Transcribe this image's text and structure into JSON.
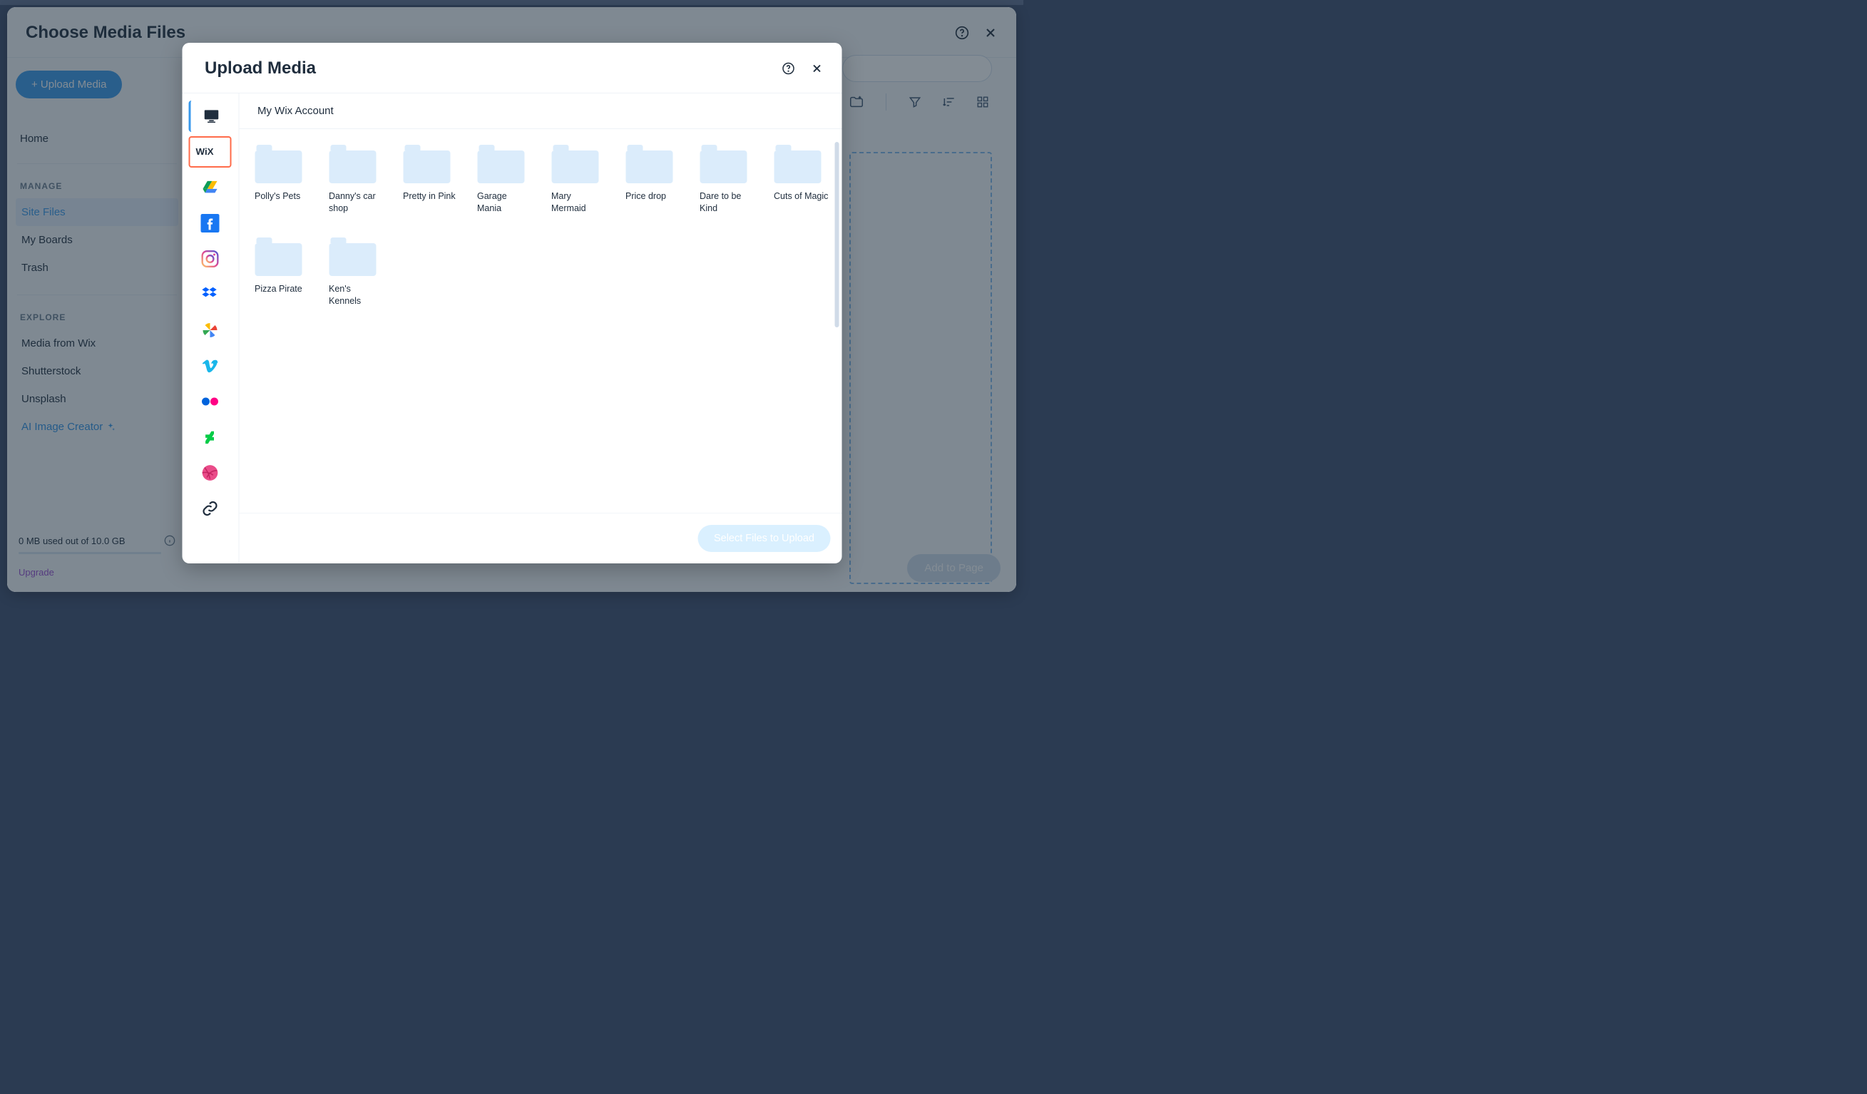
{
  "outer": {
    "title": "Choose Media Files",
    "upload_btn": "+ Upload Media",
    "home_link": "Home",
    "manage_label": "MANAGE",
    "manage_items": [
      "Site Files",
      "My Boards",
      "Trash"
    ],
    "explore_label": "EXPLORE",
    "explore_items": [
      "Media from Wix",
      "Shutterstock",
      "Unsplash"
    ],
    "ai_creator": "AI Image Creator",
    "storage_text": "0 MB used out of 10.0 GB",
    "upgrade_link": "Upgrade",
    "add_to_page": "Add to Page"
  },
  "inner": {
    "title": "Upload Media",
    "breadcrumb": "My Wix Account",
    "select_btn": "Select Files to Upload",
    "sources": [
      {
        "name": "computer",
        "active_left": true,
        "highlighted": false
      },
      {
        "name": "wix",
        "active_left": false,
        "highlighted": true
      },
      {
        "name": "gdrive",
        "active_left": false,
        "highlighted": false
      },
      {
        "name": "facebook",
        "active_left": false,
        "highlighted": false
      },
      {
        "name": "instagram",
        "active_left": false,
        "highlighted": false
      },
      {
        "name": "dropbox",
        "active_left": false,
        "highlighted": false
      },
      {
        "name": "gphotos",
        "active_left": false,
        "highlighted": false
      },
      {
        "name": "vimeo",
        "active_left": false,
        "highlighted": false
      },
      {
        "name": "flickr",
        "active_left": false,
        "highlighted": false
      },
      {
        "name": "deviantart",
        "active_left": false,
        "highlighted": false
      },
      {
        "name": "dribbble",
        "active_left": false,
        "highlighted": false
      },
      {
        "name": "url",
        "active_left": false,
        "highlighted": false
      }
    ],
    "folders": [
      "Polly's Pets",
      "Danny's car shop",
      "Pretty in Pink",
      "Garage Mania",
      "Mary Mermaid",
      "Price drop",
      "Dare to be Kind",
      "Cuts of Magic",
      "Pizza Pirate",
      "Ken's Kennels"
    ]
  }
}
